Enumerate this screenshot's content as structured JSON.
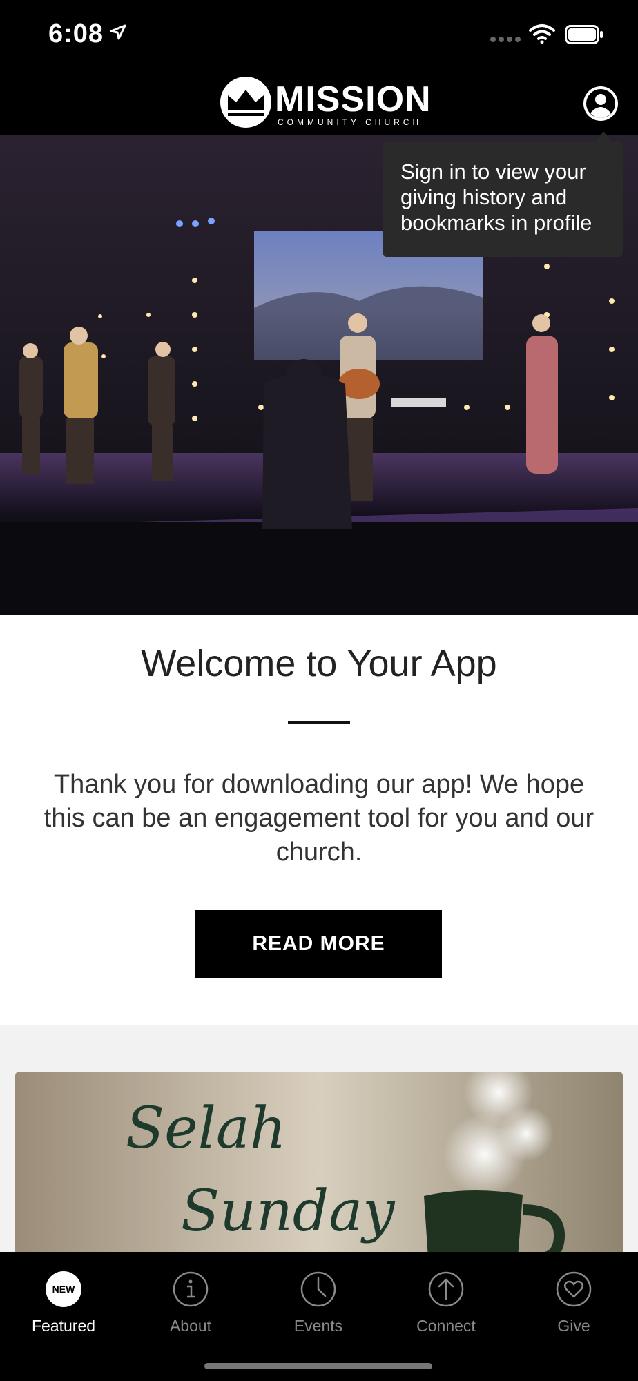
{
  "status_bar": {
    "time": "6:08"
  },
  "header": {
    "logo_word": "MISSION",
    "logo_sub": "COMMUNITY CHURCH"
  },
  "tooltip": {
    "text": "Sign in to view your giving history and bookmarks in profile"
  },
  "welcome": {
    "title": "Welcome to Your App",
    "body": "Thank you for downloading our app! We hope this can be an engagement tool for you and our church.",
    "button_label": "READ MORE"
  },
  "card": {
    "line1": "Selah",
    "line2": "Sunday"
  },
  "tabs": [
    {
      "label": "Featured",
      "icon": "new-badge-icon",
      "badge": "NEW",
      "active": true
    },
    {
      "label": "About",
      "icon": "info-icon"
    },
    {
      "label": "Events",
      "icon": "clock-icon"
    },
    {
      "label": "Connect",
      "icon": "arrow-up-circle-icon"
    },
    {
      "label": "Give",
      "icon": "heart-circle-icon"
    }
  ],
  "colors": {
    "background": "#000000",
    "text_dark": "#222222",
    "tooltip": "#2a2a2a"
  }
}
